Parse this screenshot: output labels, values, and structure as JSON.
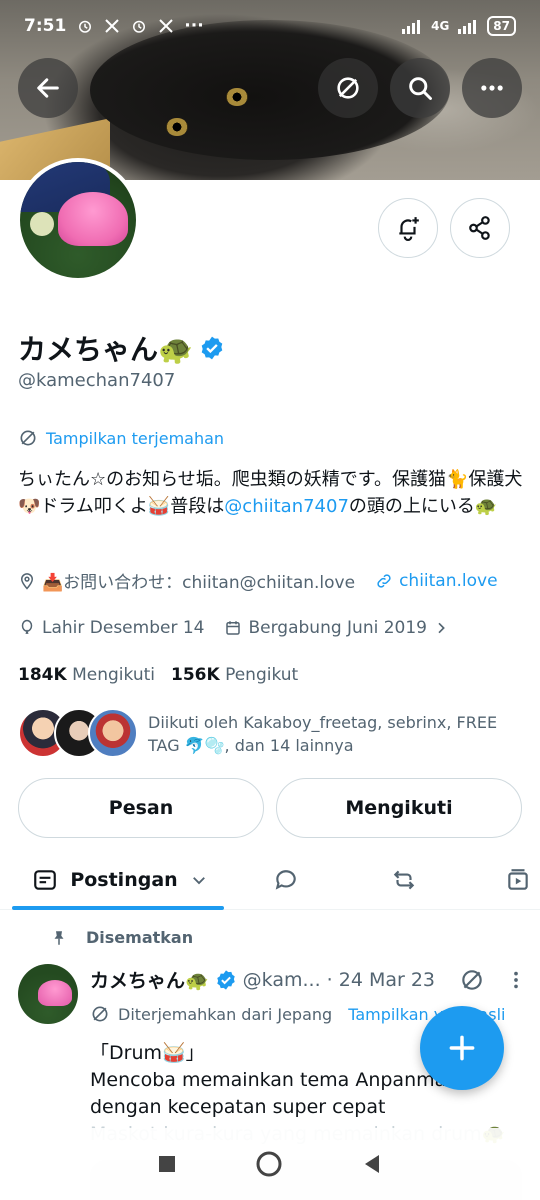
{
  "status_bar": {
    "time": "7:51",
    "notif_icons": [
      "alarm-icon",
      "x-logo-icon",
      "alarm-icon",
      "x-logo-icon"
    ],
    "more": "···",
    "network": "4G",
    "battery": "87"
  },
  "profile": {
    "name": "カメちゃん🐢",
    "handle": "@kamechan7407",
    "translate_label": "Tampilkan terjemahan",
    "bio_part1": "ちぃたん☆のお知らせ垢。爬虫類の妖精です。保護猫🐈保護犬🐶ドラム叩くよ🥁普段は",
    "bio_mention": "@chiitan7407",
    "bio_part2": "の頭の上にいる🐢",
    "contact": "📥お問い合わせ：chiitan@chiitan.love",
    "website": "chiitan.love",
    "birthday": "Lahir Desember 14",
    "joined": "Bergabung Juni 2019",
    "following_count": "184K",
    "following_label": "Mengikuti",
    "followers_count": "156K",
    "followers_label": "Pengikut",
    "followed_by": "Diikuti oleh Kakaboy_freetag, sebrinx, FREE TAG 🐬🫧, dan 14 lainnya"
  },
  "actions": {
    "message": "Pesan",
    "following": "Mengikuti"
  },
  "tabs": {
    "posts": "Postingan"
  },
  "pinned_post": {
    "pinned_label": "Disematkan",
    "author": "カメちゃん🐢",
    "handle_date": "@kam... · 24 Mar 23",
    "translated_from": "Diterjemahkan dari Jepang",
    "show_original": "Tampilkan yang asli",
    "line1": "「Drum🥁」",
    "line2": "Mencoba memainkan tema Anpanman",
    "line3": "dengan kecepatan super cepat",
    "line4": "Maskot kura-kura yang memainkan drum🐢"
  },
  "colors": {
    "accent": "#1d9bf0",
    "text": "#0f1419",
    "muted": "#536471"
  }
}
